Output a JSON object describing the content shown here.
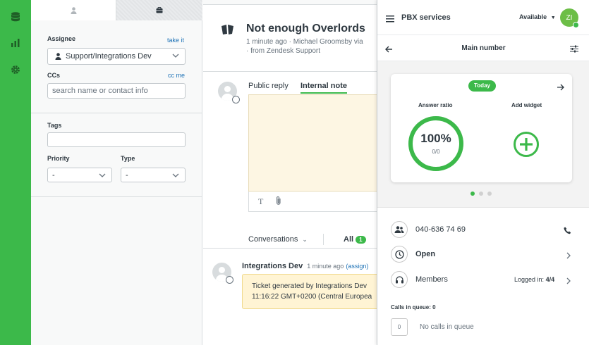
{
  "properties": {
    "assignee_label": "Assignee",
    "take_it": "take it",
    "assignee_value": "Support/Integrations Dev",
    "ccs_label": "CCs",
    "cc_me": "cc me",
    "ccs_placeholder": "search name or contact info",
    "tags_label": "Tags",
    "priority_label": "Priority",
    "priority_value": "-",
    "type_label": "Type",
    "type_value": "-"
  },
  "ticket": {
    "title": "Not enough Overlords",
    "meta_line1": "1 minute ago · Michael Groomsby  via",
    "meta_line2": "· from Zendesk Support",
    "reply_tab_public": "Public reply",
    "reply_tab_internal": "Internal note",
    "conversations_label": "Conversations",
    "all_label": "All",
    "all_count": "1",
    "event_author": "Integrations Dev",
    "event_time": "1 minute ago",
    "event_assign": "(assign)",
    "event_line1": "Ticket generated by Integrations Dev",
    "event_line2": "11:16:22 GMT+0200 (Central Europea"
  },
  "app": {
    "title": "PBX services",
    "status": "Available",
    "avatar_initials": "ZI",
    "subheader_title": "Main number",
    "card": {
      "today": "Today",
      "answer_ratio_label": "Answer ratio",
      "answer_ratio_value": "100%",
      "answer_ratio_sub": "0/0",
      "answer_ratio_fraction": 1.0,
      "add_widget_label": "Add widget"
    },
    "phone_number": "040-636 74 69",
    "open_label": "Open",
    "members_label": "Members",
    "logged_in_label": "Logged in:",
    "logged_in_value": "4/4",
    "calls_in_queue_label": "Calls in queue:",
    "calls_in_queue_value": "0",
    "queue_count": "0",
    "no_calls_text": "No calls in queue"
  },
  "colors": {
    "brand_green": "#3cb94a",
    "link_blue": "#1f73b7"
  }
}
